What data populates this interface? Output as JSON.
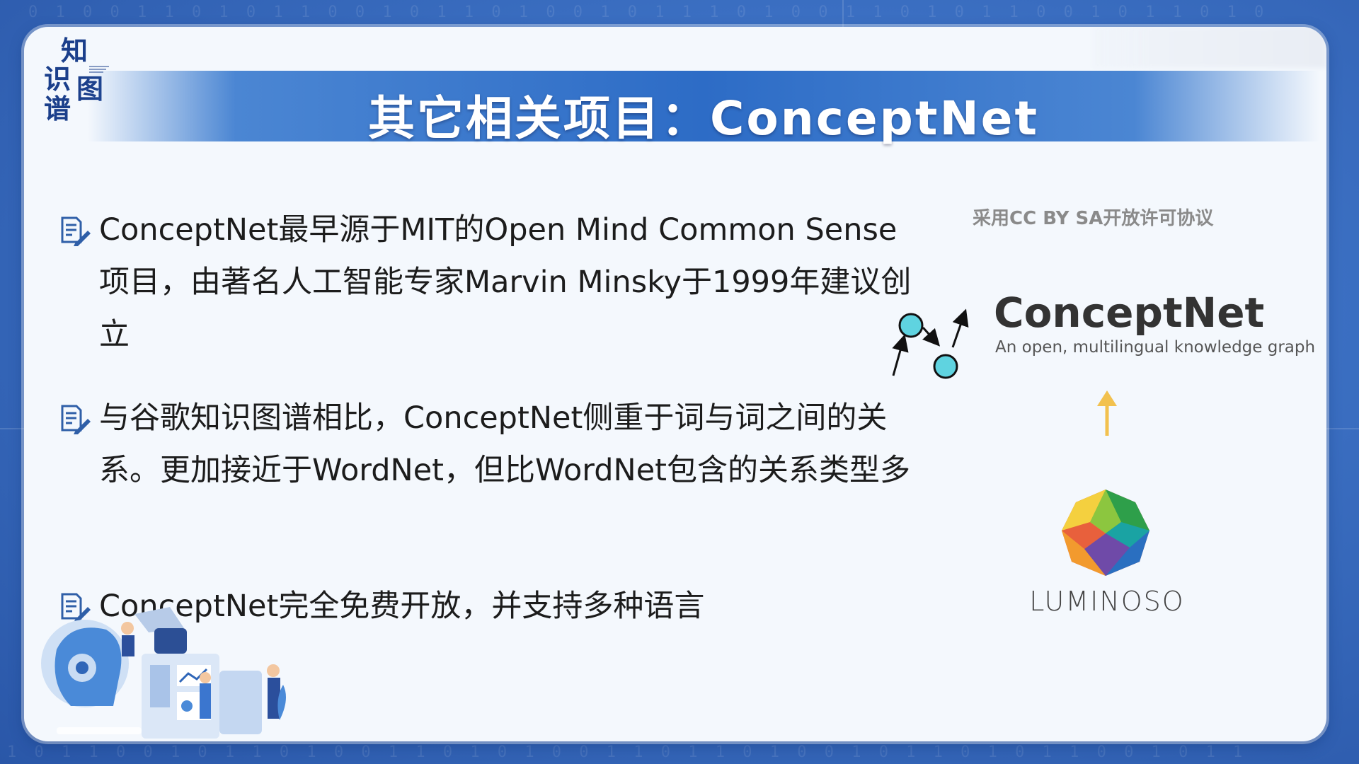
{
  "logo": {
    "chars": [
      "知",
      "识",
      "图",
      "谱"
    ]
  },
  "title": "其它相关项目：ConceptNet",
  "bullets": [
    {
      "text": "ConceptNet最早源于MIT的Open Mind Common Sense项目，由著名人工智能专家Marvin Minsky于1999年建议创立"
    },
    {
      "text": "与谷歌知识图谱相比，ConceptNet侧重于词与词之间的关系。更加接近于WordNet，但比WordNet包含的关系类型多"
    },
    {
      "text": "ConceptNet完全免费开放，并支持多种语言"
    }
  ],
  "right": {
    "license_note": "采用CC BY SA开放许可协议",
    "wordmark": "ConceptNet",
    "tagline": "An open, multilingual knowledge graph",
    "partner": "LUMINOSO"
  },
  "colors": {
    "title_band": "#2d6cc6",
    "node_fill": "#5fd3e0",
    "arrow_yellow": "#f2c14e"
  }
}
